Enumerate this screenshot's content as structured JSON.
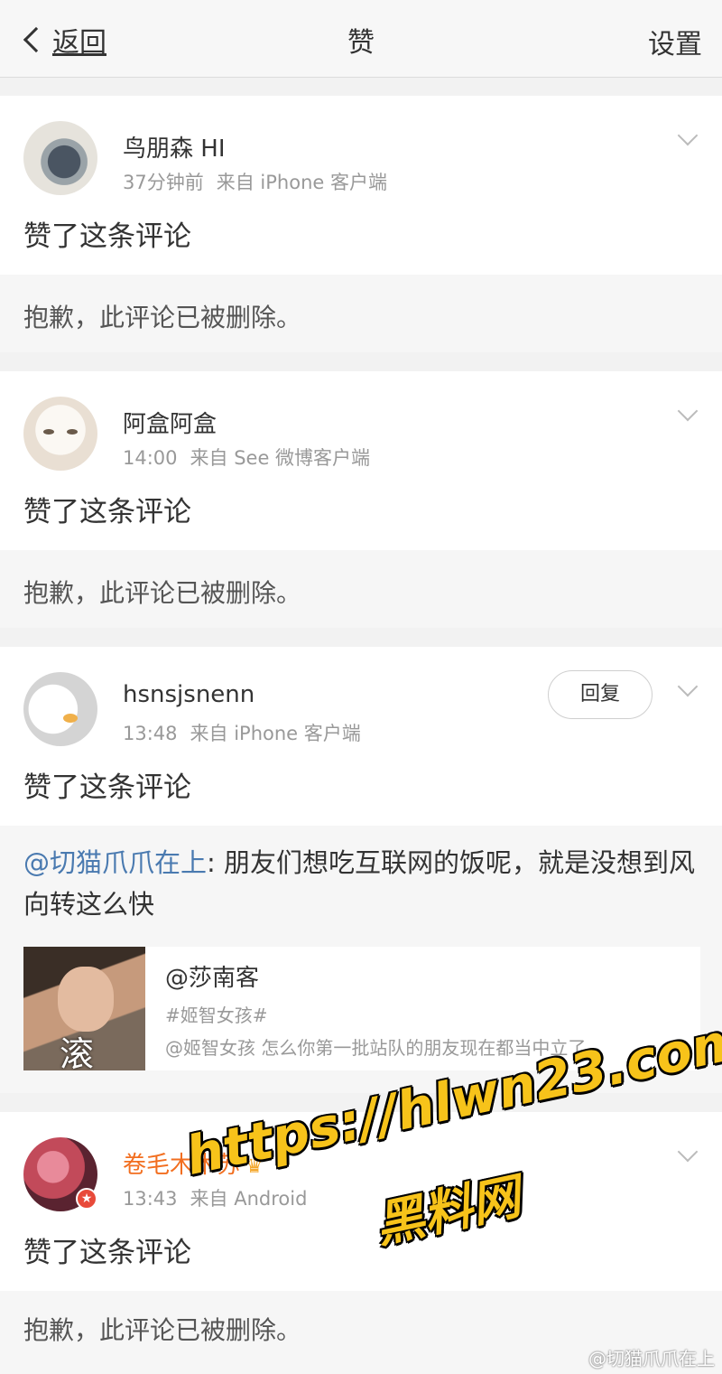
{
  "nav": {
    "back_label": "返回",
    "title": "赞",
    "settings_label": "设置"
  },
  "items": [
    {
      "username": "鸟朋森 HI",
      "time": "37分钟前",
      "source": "来自 iPhone 客户端",
      "action": "赞了这条评论",
      "deleted_text": "抱歉，此评论已被删除。"
    },
    {
      "username": "阿盒阿盒",
      "time": "14:00",
      "source": "来自 See 微博客户端",
      "action": "赞了这条评论",
      "deleted_text": "抱歉，此评论已被删除。"
    },
    {
      "username": "hsnsjsnenn",
      "time": "13:48",
      "source": "来自 iPhone 客户端",
      "action": "赞了这条评论",
      "reply_label": "回复",
      "quoted": {
        "mention": "@切猫爪爪在上",
        "text": ": 朋友们想吃互联网的饭呢，就是没想到风向转这么快",
        "attachment": {
          "title": "@莎南客",
          "tag": "#姬智女孩#",
          "desc": "@姬智女孩 怎么你第一批站队的朋友现在都当中立了",
          "thumb_overlay": "滚"
        }
      }
    },
    {
      "username": "卷毛木木苏",
      "time": "13:43",
      "source": "来自 Android",
      "action": "赞了这条评论",
      "deleted_text": "抱歉，此评论已被删除。"
    }
  ],
  "watermark": {
    "url": "https://hlwn23.com",
    "label": "黑料网",
    "corner": "@切猫爪爪在上"
  },
  "colors": {
    "mention": "#4a7ab0",
    "vip_name": "#f26e1f",
    "watermark": "#f7c31a"
  }
}
